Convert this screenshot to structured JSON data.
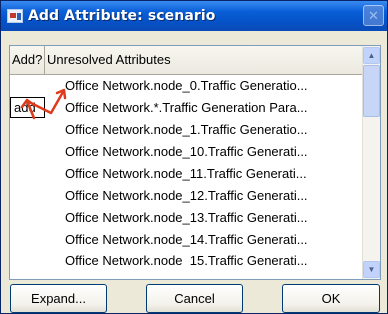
{
  "window": {
    "title": "Add Attribute: scenario",
    "close_glyph": "✕"
  },
  "table": {
    "columns": [
      "Add?",
      "Unresolved Attributes"
    ],
    "rows": [
      {
        "add": "",
        "attribute": "Office Network.node_0.Traffic Generatio..."
      },
      {
        "add": "add",
        "attribute": "Office Network.*.Traffic Generation Para..."
      },
      {
        "add": "",
        "attribute": "Office Network.node_1.Traffic Generatio..."
      },
      {
        "add": "",
        "attribute": "Office Network.node_10.Traffic Generati..."
      },
      {
        "add": "",
        "attribute": "Office Network.node_11.Traffic Generati..."
      },
      {
        "add": "",
        "attribute": "Office Network.node_12.Traffic Generati..."
      },
      {
        "add": "",
        "attribute": "Office Network.node_13.Traffic Generati..."
      },
      {
        "add": "",
        "attribute": "Office Network.node_14.Traffic Generati..."
      },
      {
        "add": "",
        "attribute": "Office Network.node_15.Traffic Generati..."
      }
    ]
  },
  "buttons": {
    "expand": "Expand...",
    "cancel": "Cancel",
    "ok": "OK"
  },
  "annotation": {
    "arrow_color": "#e03a1c"
  },
  "colors": {
    "titlebar": "#0553c8",
    "dialog_bg": "#ece9d8",
    "button_border": "#003c74"
  }
}
